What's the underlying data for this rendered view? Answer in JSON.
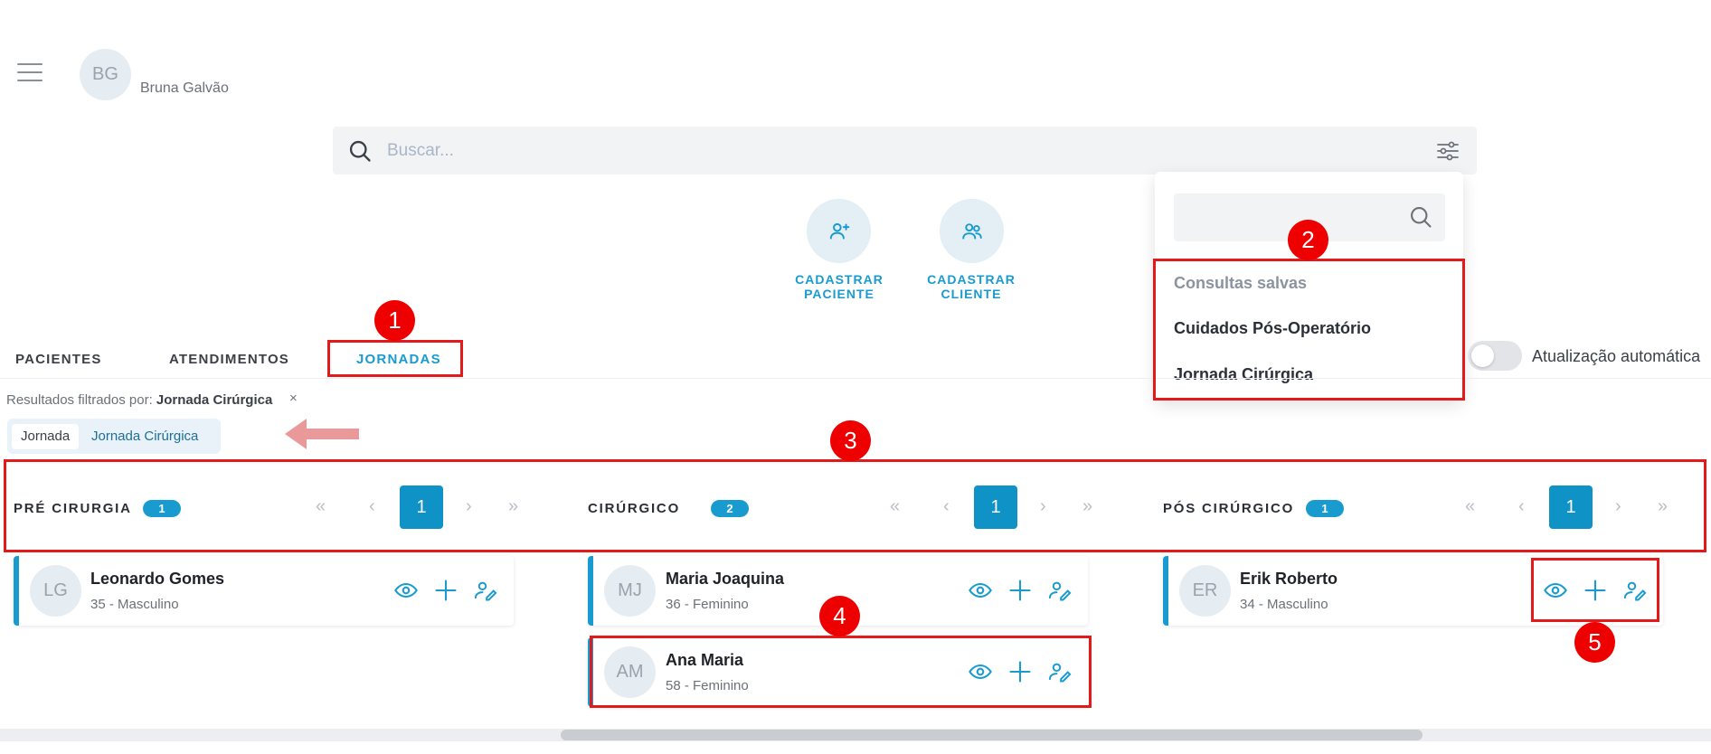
{
  "header": {
    "avatar_initials": "BG",
    "user_name": "Bruna Galvão"
  },
  "search": {
    "placeholder": "Buscar..."
  },
  "actions": [
    {
      "label_line1": "CADASTRAR",
      "label_line2": "PACIENTE",
      "icon": "user-plus-icon"
    },
    {
      "label_line1": "CADASTRAR",
      "label_line2": "CLIENTE",
      "icon": "users-icon"
    }
  ],
  "dropdown": {
    "header": "Consultas salvas",
    "items": [
      "Cuidados Pós-Operatório",
      "Jornada Cirúrgica"
    ]
  },
  "tabs": [
    {
      "label": "PACIENTES",
      "active": false
    },
    {
      "label": "ATENDIMENTOS",
      "active": false
    },
    {
      "label": "JORNADAS",
      "active": true
    }
  ],
  "toggle": {
    "label": "Atualização automática",
    "on": false
  },
  "filter": {
    "prefix": "Resultados filtrados por:",
    "value": "Jornada Cirúrgica",
    "close": "×",
    "chip_key": "Jornada",
    "chip_value": "Jornada Cirúrgica"
  },
  "columns": [
    {
      "title": "PRÉ CIRURGIA",
      "count": "1",
      "page": "1",
      "cards": [
        {
          "initials": "LG",
          "name": "Leonardo Gomes",
          "sub": "35 - Masculino"
        }
      ]
    },
    {
      "title": "CIRÚRGICO",
      "count": "2",
      "page": "1",
      "cards": [
        {
          "initials": "MJ",
          "name": "Maria Joaquina",
          "sub": "36 - Feminino"
        },
        {
          "initials": "AM",
          "name": "Ana Maria",
          "sub": "58 - Feminino"
        }
      ]
    },
    {
      "title": "PÓS CIRÚRGICO",
      "count": "1",
      "page": "1",
      "cards": [
        {
          "initials": "ER",
          "name": "Erik Roberto",
          "sub": "34 - Masculino"
        }
      ]
    }
  ],
  "pagination": {
    "first": "«",
    "prev": "‹",
    "next": "›",
    "last": "»"
  },
  "annotations": [
    "1",
    "2",
    "3",
    "4",
    "5"
  ],
  "colors": {
    "accent": "#1a9bd0",
    "annotation": "#e41a1a"
  }
}
